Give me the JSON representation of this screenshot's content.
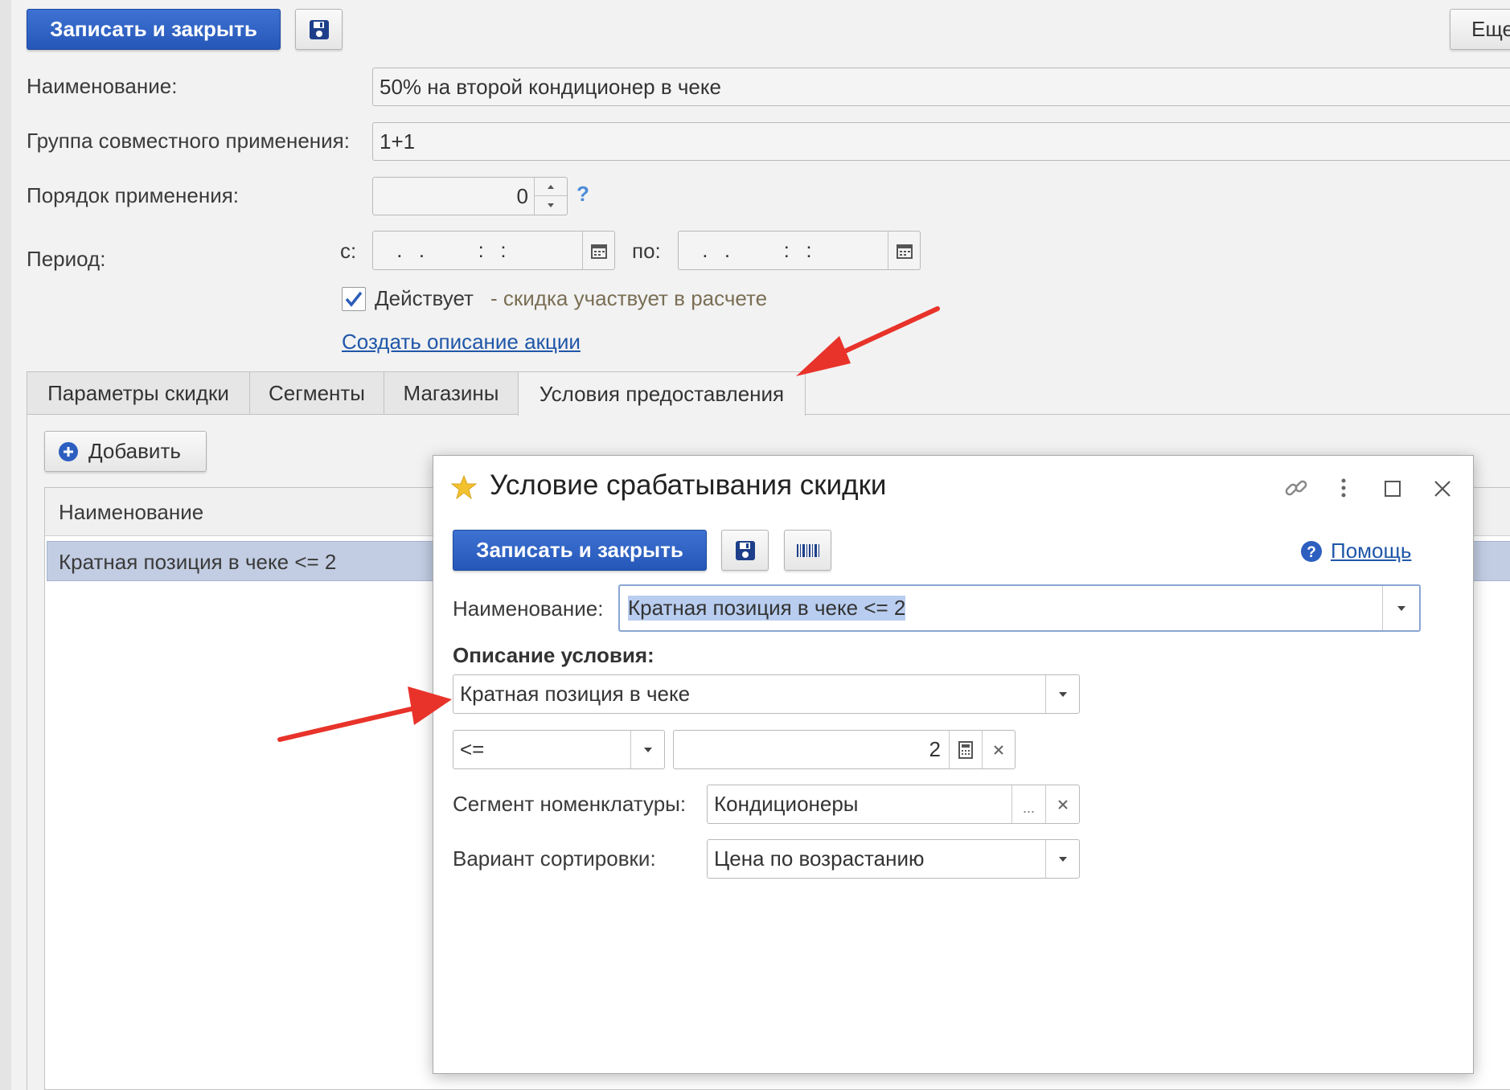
{
  "toolbar": {
    "save_close_label": "Записать и закрыть",
    "more_label": "Еще"
  },
  "form": {
    "name_label": "Наименование:",
    "name_value": "50% на второй кондиционер в чеке",
    "group_label": "Группа совместного применения:",
    "group_value": "1+1",
    "order_label": "Порядок применения:",
    "order_value": "0",
    "help_mark": "?",
    "period_label": "Период:",
    "from_label": "с:",
    "from_value": " .  .       :  :",
    "to_label": "по:",
    "to_value": " .  .       :  :",
    "active_label": "Действует",
    "active_checked": true,
    "active_hint": "- скидка участвует в расчете",
    "create_description_link": "Создать описание акции"
  },
  "tabs": [
    {
      "label": "Параметры скидки",
      "active": false
    },
    {
      "label": "Сегменты",
      "active": false
    },
    {
      "label": "Магазины",
      "active": false
    },
    {
      "label": "Условия предоставления",
      "active": true
    }
  ],
  "conditions": {
    "add_label": "Добавить",
    "column_header": "Наименование",
    "rows": [
      "Кратная позиция в чеке <= 2"
    ]
  },
  "dialog": {
    "title": "Условие срабатывания скидки",
    "save_close_label": "Записать и закрыть",
    "help_label": "Помощь",
    "name_label": "Наименование:",
    "name_value": "Кратная позиция в чеке <= 2",
    "description_heading": "Описание условия:",
    "condition_type": "Кратная позиция в чеке",
    "comparison": "<=",
    "comparison_value": "2",
    "segment_label": "Сегмент номенклатуры:",
    "segment_value": "Кондиционеры",
    "sort_label": "Вариант сортировки:",
    "sort_value": "Цена по возрастанию",
    "ellipsis": "..."
  },
  "colors": {
    "accent": "#2f62c4",
    "selected_row": "#c2cde3",
    "annotation_arrow": "#e8332a",
    "link": "#1f57a8",
    "hint": "#7a6f55"
  }
}
